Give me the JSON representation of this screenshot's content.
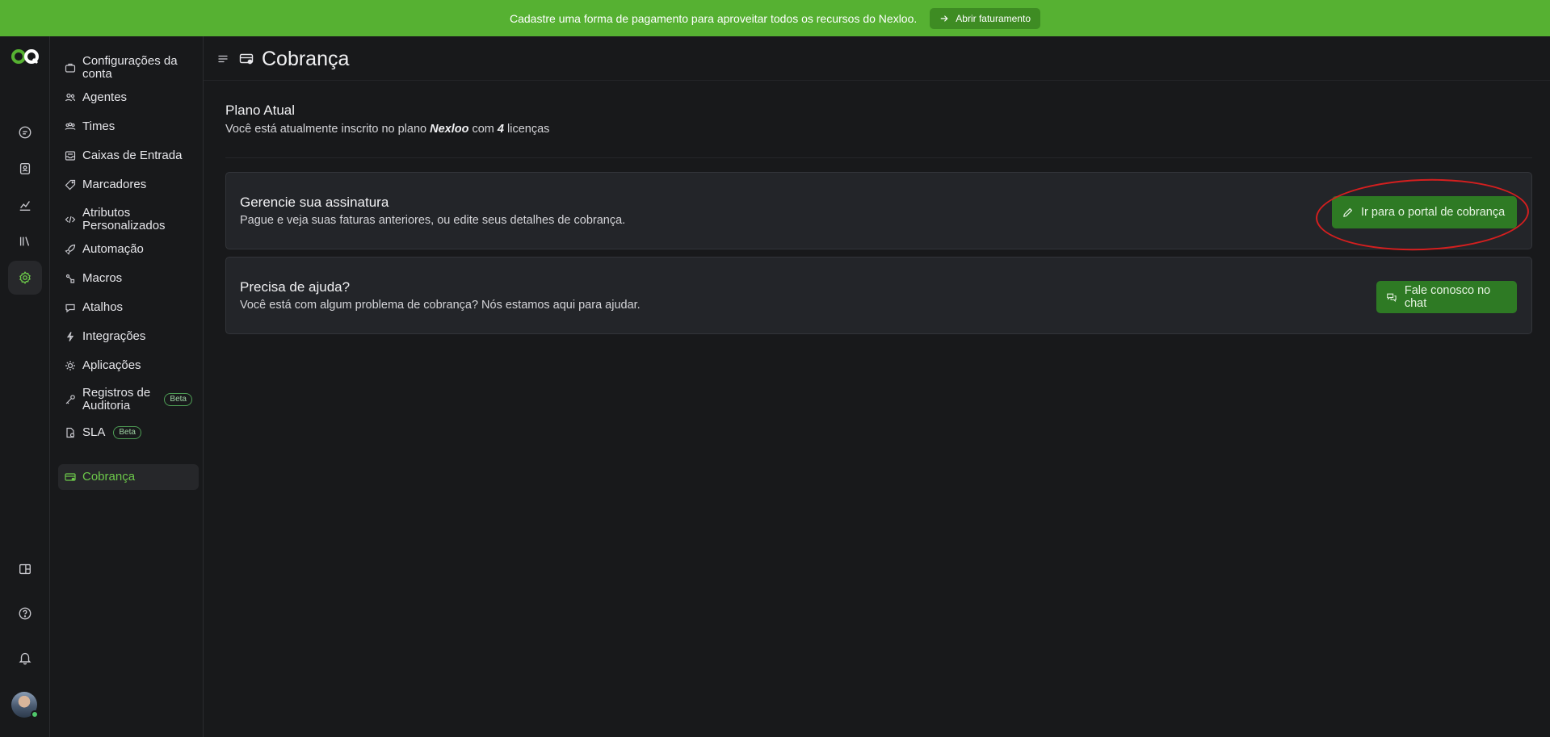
{
  "banner": {
    "message": "Cadastre uma forma de pagamento para aproveitar todos os recursos do Nexloo.",
    "button_label": "Abrir faturamento"
  },
  "rail": {
    "items": [
      {
        "icon": "chat-icon"
      },
      {
        "icon": "contacts-icon"
      },
      {
        "icon": "reports-icon"
      },
      {
        "icon": "library-icon"
      },
      {
        "icon": "settings-icon",
        "active": true
      },
      {
        "icon": "layout-icon"
      },
      {
        "icon": "help-icon"
      },
      {
        "icon": "bell-icon"
      }
    ]
  },
  "sidebar": {
    "items": [
      {
        "label": "Configurações da conta",
        "icon": "briefcase-icon"
      },
      {
        "label": "Agentes",
        "icon": "users-icon"
      },
      {
        "label": "Times",
        "icon": "team-icon"
      },
      {
        "label": "Caixas de Entrada",
        "icon": "inbox-icon"
      },
      {
        "label": "Marcadores",
        "icon": "tag-icon"
      },
      {
        "label": "Atributos Personalizados",
        "icon": "code-icon"
      },
      {
        "label": "Automação",
        "icon": "rocket-icon"
      },
      {
        "label": "Macros",
        "icon": "macro-icon"
      },
      {
        "label": "Atalhos",
        "icon": "speech-icon"
      },
      {
        "label": "Integrações",
        "icon": "plug-icon"
      },
      {
        "label": "Aplicações",
        "icon": "apps-icon"
      },
      {
        "label": "Registros de Auditoria",
        "icon": "key-icon",
        "badge": "Beta"
      },
      {
        "label": "SLA",
        "icon": "document-icon",
        "badge": "Beta"
      },
      {
        "label": "Cobrança",
        "icon": "billing-icon",
        "active": true
      }
    ]
  },
  "header": {
    "title": "Cobrança"
  },
  "plan": {
    "title": "Plano Atual",
    "desc_prefix": "Você está atualmente inscrito no plano ",
    "plan_name": "Nexloo",
    "desc_middle": " com ",
    "license_count": "4",
    "desc_suffix": " licenças"
  },
  "cards": {
    "subscription": {
      "title": "Gerencie sua assinatura",
      "desc": "Pague e veja suas faturas anteriores, ou edite seus detalhes de cobrança.",
      "button_label": "Ir para o portal de cobrança"
    },
    "help": {
      "title": "Precisa de ajuda?",
      "desc": "Você está com algum problema de cobrança? Nós estamos aqui para ajudar.",
      "button_label": "Fale conosco no chat"
    }
  },
  "colors": {
    "banner": "#56b132",
    "accent": "#6cc84a",
    "button": "#2e7a24",
    "annotation": "#d41f1f"
  }
}
